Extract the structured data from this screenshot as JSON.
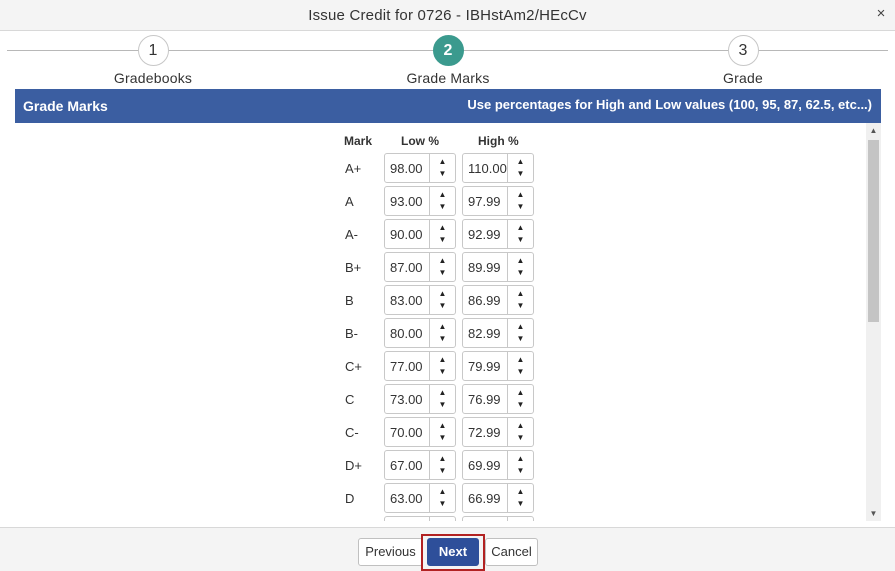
{
  "window": {
    "title": "Issue Credit for 0726 - IBHstAm2/HEcCv",
    "close_glyph": "×"
  },
  "stepper": {
    "steps": [
      {
        "number": "1",
        "label": "Gradebooks",
        "active": false
      },
      {
        "number": "2",
        "label": "Grade Marks",
        "active": true
      },
      {
        "number": "3",
        "label": "Grade",
        "active": false
      }
    ],
    "active_color": "#3b9a8e"
  },
  "section": {
    "title": "Grade Marks",
    "hint": "Use percentages for High and Low values (100, 95, 87, 62.5, etc...)",
    "bar_color": "#3b5ea1"
  },
  "table": {
    "headers": {
      "mark": "Mark",
      "low": "Low %",
      "high": "High %"
    },
    "rows": [
      {
        "mark": "A+",
        "low": "98.00",
        "high": "110.00"
      },
      {
        "mark": "A",
        "low": "93.00",
        "high": "97.99"
      },
      {
        "mark": "A-",
        "low": "90.00",
        "high": "92.99"
      },
      {
        "mark": "B+",
        "low": "87.00",
        "high": "89.99"
      },
      {
        "mark": "B",
        "low": "83.00",
        "high": "86.99"
      },
      {
        "mark": "B-",
        "low": "80.00",
        "high": "82.99"
      },
      {
        "mark": "C+",
        "low": "77.00",
        "high": "79.99"
      },
      {
        "mark": "C",
        "low": "73.00",
        "high": "76.99"
      },
      {
        "mark": "C-",
        "low": "70.00",
        "high": "72.99"
      },
      {
        "mark": "D+",
        "low": "67.00",
        "high": "69.99"
      },
      {
        "mark": "D",
        "low": "63.00",
        "high": "66.99"
      },
      {
        "mark": "",
        "low": "",
        "high": ""
      }
    ]
  },
  "footer": {
    "previous_label": "Previous",
    "next_label": "Next",
    "cancel_label": "Cancel",
    "next_color": "#2e4f9a",
    "highlight_color": "#b22222"
  },
  "icons": {
    "spin_up": "▲",
    "spin_down": "▼",
    "scroll_up": "▲",
    "scroll_down": "▼"
  }
}
